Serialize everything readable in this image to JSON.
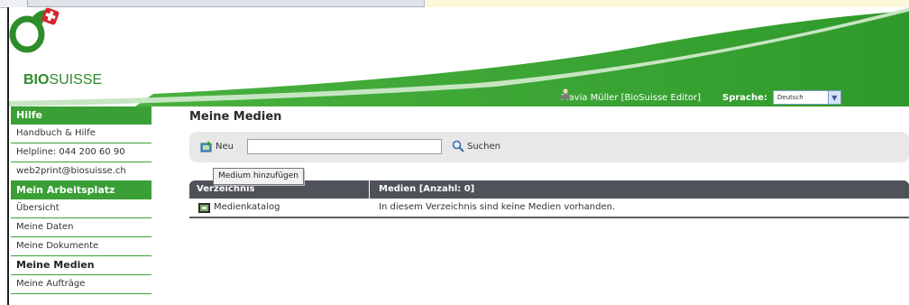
{
  "brand": {
    "logo_bold": "BIO",
    "logo_regular": "SUISSE"
  },
  "colors": {
    "accent_green": "#3aa035",
    "header_dark": "#4e5259"
  },
  "header": {
    "user": "Flavia Müller [BioSuisse Editor]",
    "language_label": "Sprache:",
    "language_value": "Deutsch"
  },
  "sidebar": {
    "sections": [
      {
        "title": "Hilfe",
        "items": [
          "Handbuch & Hilfe",
          "Helpline: 044 200 60 90",
          "web2print@biosuisse.ch"
        ]
      },
      {
        "title": "Mein Arbeitsplatz",
        "items": [
          "Übersicht",
          "Meine Daten",
          "Meine Dokumente",
          "Meine Medien",
          "Meine Aufträge"
        ]
      }
    ],
    "active_item": "Meine Medien"
  },
  "main": {
    "title": "Meine Medien",
    "toolbar": {
      "new_label": "Neu",
      "search_value": "",
      "search_label": "Suchen",
      "tooltip": "Medium hinzufügen"
    },
    "table": {
      "col_directory": "Verzeichnis",
      "col_media": "Medien  [Anzahl: 0]",
      "rows": [
        {
          "directory": "Medienkatalog",
          "media": "In diesem Verzeichnis sind keine Medien vorhanden."
        }
      ]
    }
  }
}
